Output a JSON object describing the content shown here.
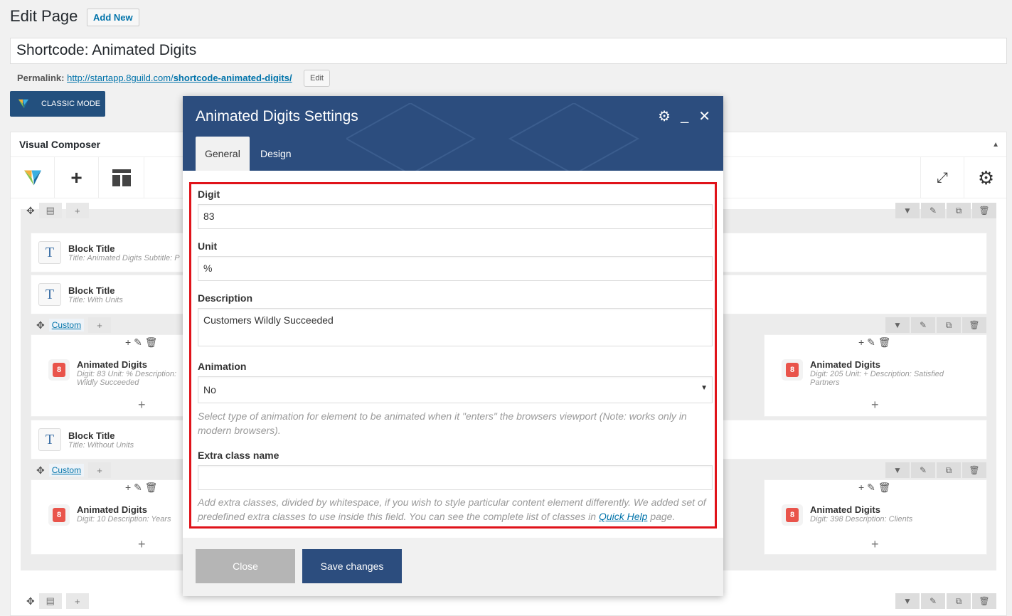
{
  "header": {
    "title": "Edit Page",
    "add_new": "Add New"
  },
  "post_title": "Shortcode: Animated Digits",
  "permalink": {
    "label": "Permalink:",
    "url_base": "http://startapp.8guild.com/",
    "url_slug": "shortcode-animated-digits/",
    "edit": "Edit"
  },
  "classic_mode": "CLASSIC MODE",
  "vc": {
    "title": "Visual Composer"
  },
  "elements": {
    "block1": {
      "name": "Block Title",
      "desc": "Title: Animated Digits  Subtitle: P"
    },
    "block2": {
      "name": "Block Title",
      "desc": "Title: With Units"
    },
    "block3": {
      "name": "Block Title",
      "desc": "Title: Without Units"
    },
    "custom1": "Custom",
    "custom2": "Custom",
    "ad1": {
      "name": "Animated Digits",
      "desc1": "Digit: 83  Unit: %  Description:",
      "desc2": "Wildly Succeeded"
    },
    "ad2": {
      "name": "Animated Digits",
      "desc1": "Digit: 205  Unit: +  Description: Satisfied",
      "desc2": "Partners"
    },
    "ad3": {
      "name": "Animated Digits",
      "desc1": "Digit: 10  Description: Years"
    },
    "ad4": {
      "name": "Animated Digits",
      "desc1": "Digit: 398  Description: Clients"
    }
  },
  "modal": {
    "title": "Animated Digits Settings",
    "tabs": [
      "General",
      "Design"
    ],
    "fields": {
      "digit_label": "Digit",
      "digit_value": "83",
      "unit_label": "Unit",
      "unit_value": "%",
      "desc_label": "Description",
      "desc_value": "Customers Wildly Succeeded",
      "anim_label": "Animation",
      "anim_value": "No",
      "anim_help": "Select type of animation for element to be animated when it \"enters\" the browsers viewport (Note: works only in modern browsers).",
      "extra_label": "Extra class name",
      "extra_value": "",
      "extra_help": "Add extra classes, divided by whitespace, if you wish to style particular content element differently. We added set of predefined extra classes to use inside this field. You can see the complete list of classes in",
      "extra_help_link": "Quick Help",
      "extra_help_end": "page."
    },
    "close": "Close",
    "save": "Save changes"
  },
  "colors": {
    "modal_header": "#2c4d7e",
    "highlight": "#e0131a",
    "link": "#0073aa"
  }
}
